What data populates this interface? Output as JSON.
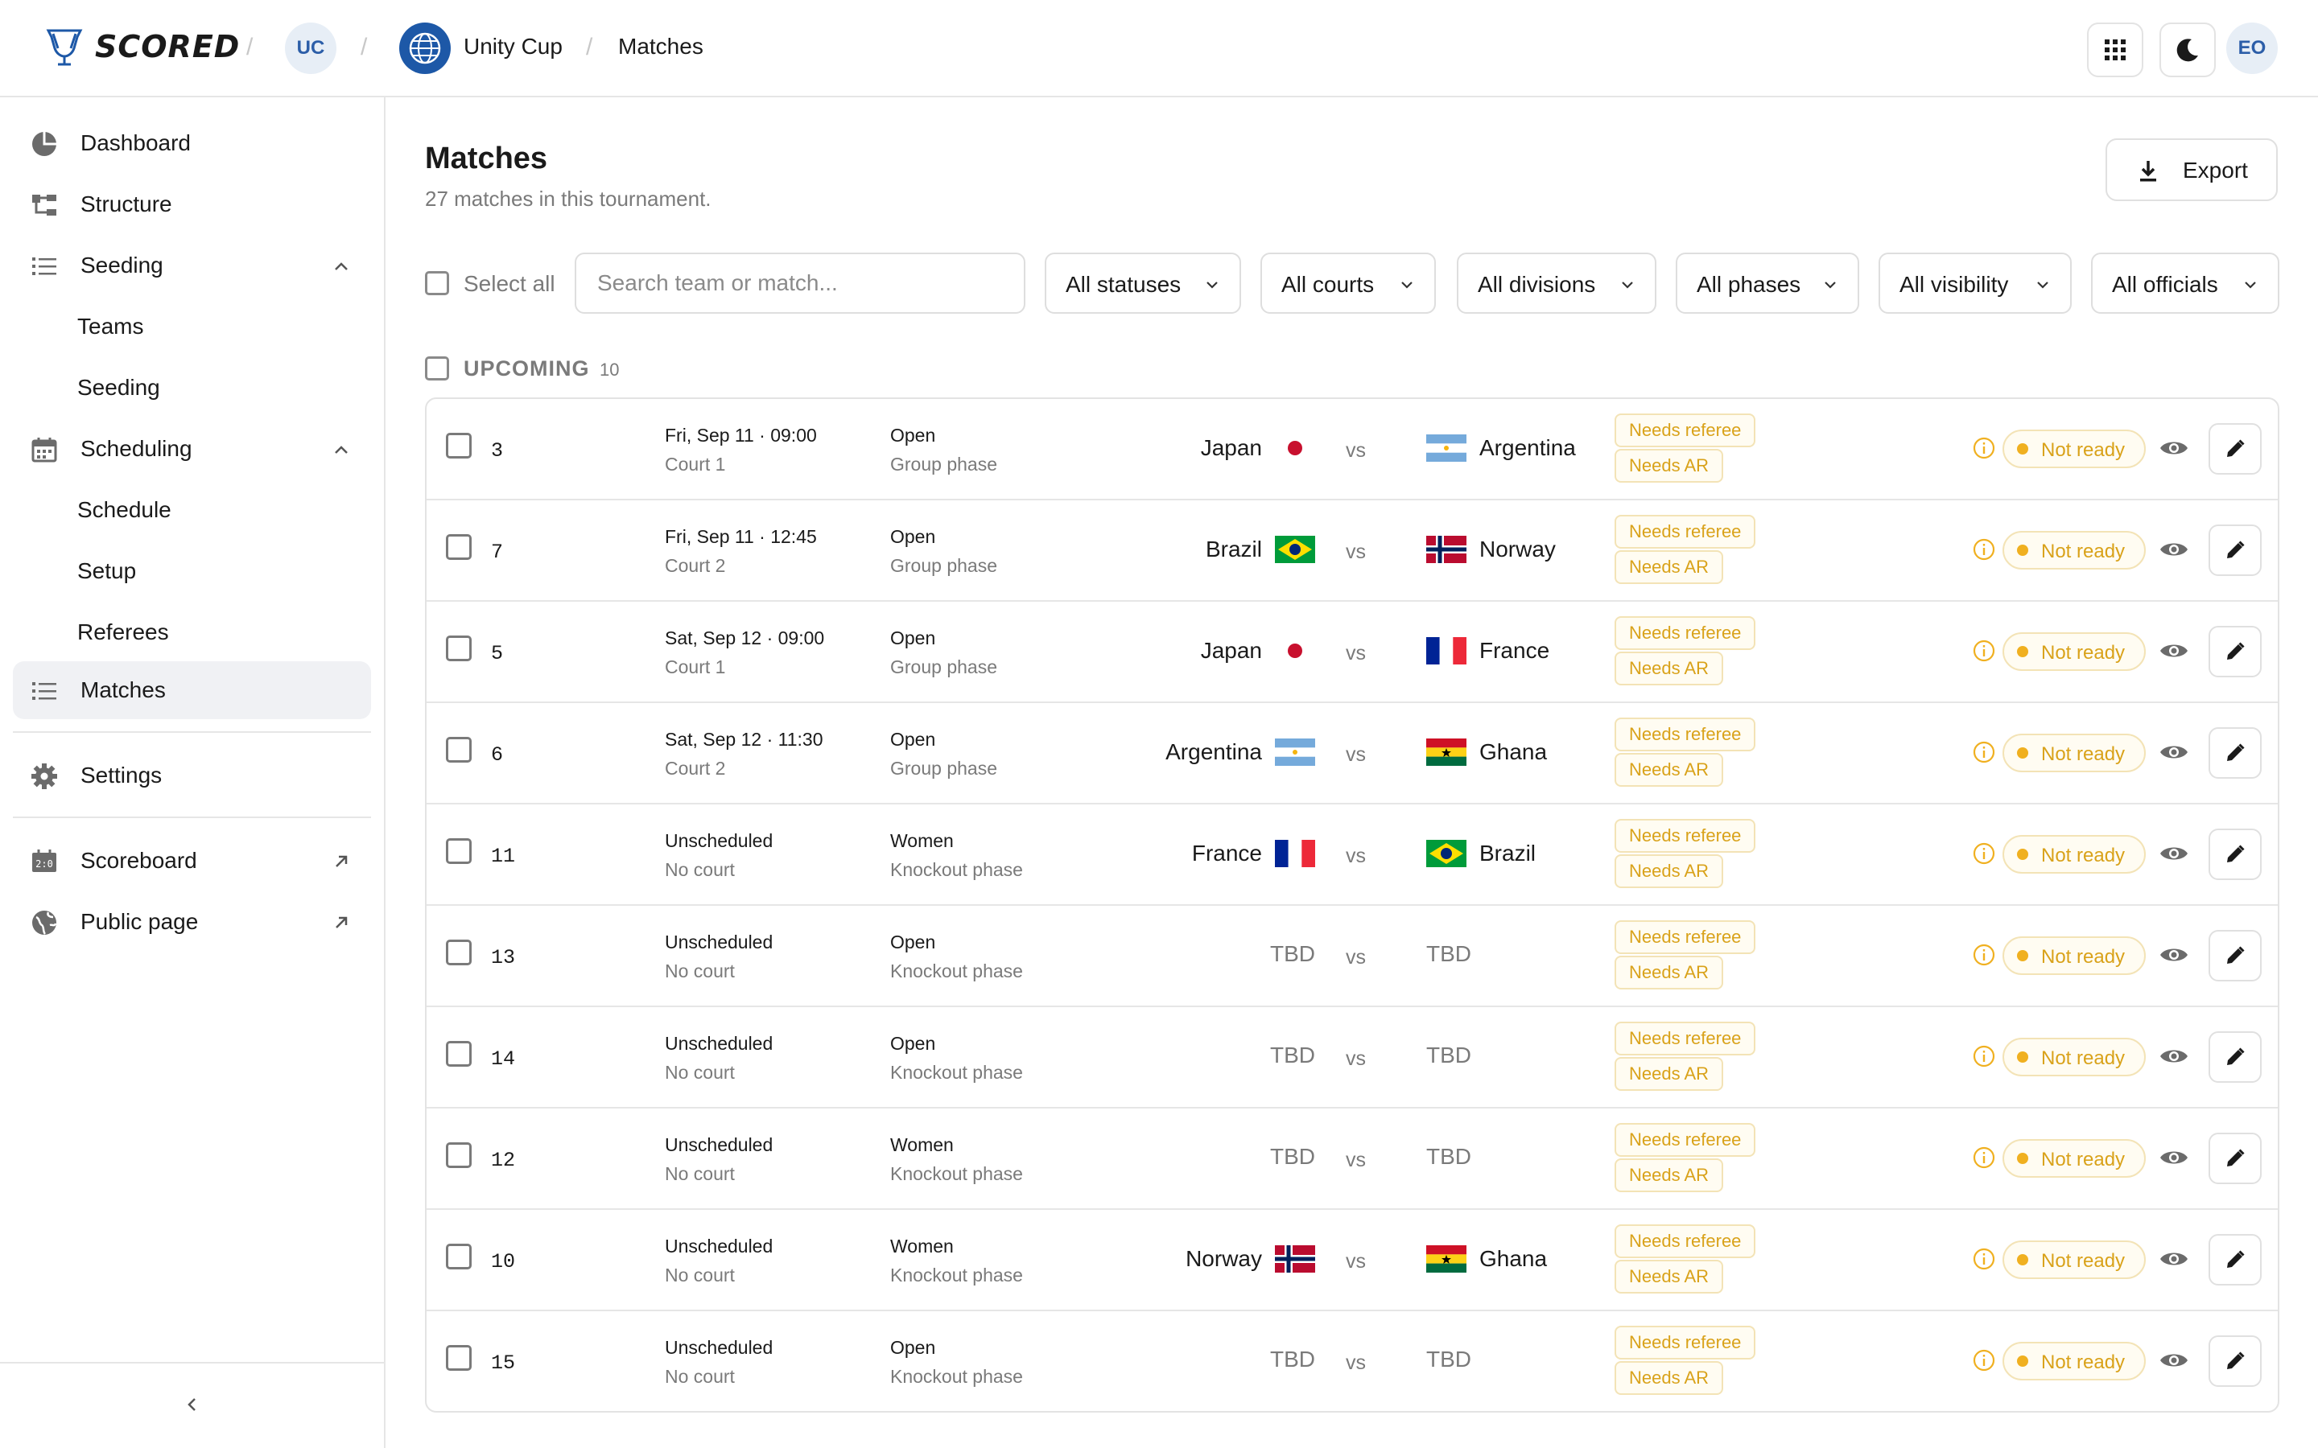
{
  "app": {
    "logo_text": "SCORED",
    "org_initials": "UC",
    "user_initials": "EO"
  },
  "breadcrumb": {
    "tournament": "Unity Cup",
    "page": "Matches"
  },
  "sidebar": {
    "items": [
      {
        "label": "Dashboard",
        "icon": "pie-chart-icon"
      },
      {
        "label": "Structure",
        "icon": "structure-icon"
      },
      {
        "label": "Seeding",
        "icon": "list-icon",
        "expanded": true
      },
      {
        "label": "Teams"
      },
      {
        "label": "Seeding"
      },
      {
        "label": "Scheduling",
        "icon": "calendar-icon",
        "expanded": true
      },
      {
        "label": "Schedule"
      },
      {
        "label": "Setup"
      },
      {
        "label": "Referees"
      },
      {
        "label": "Matches",
        "icon": "list-icon",
        "active": true
      },
      {
        "label": "Settings",
        "icon": "gear-icon"
      },
      {
        "label": "Scoreboard",
        "icon": "scoreboard-icon",
        "external": true
      },
      {
        "label": "Public page",
        "icon": "globe-icon",
        "external": true
      }
    ]
  },
  "page": {
    "title": "Matches",
    "subtitle": "27 matches in this tournament.",
    "export_label": "Export"
  },
  "filters": {
    "select_all": "Select all",
    "search_placeholder": "Search team or match...",
    "items": [
      "All statuses",
      "All courts",
      "All divisions",
      "All phases",
      "All visibility",
      "All officials"
    ]
  },
  "group": {
    "label": "UPCOMING",
    "count": "10"
  },
  "matches": [
    {
      "num": "3",
      "when": "Fri, Sep 11 · 09:00",
      "court": "Court 1",
      "division": "Open",
      "phase": "Group phase",
      "home": "Japan",
      "home_flag": "japan",
      "away": "Argentina",
      "away_flag": "argentina",
      "vs": "vs",
      "tag1": "Needs referee",
      "tag2": "Needs AR",
      "status": "Not ready"
    },
    {
      "num": "7",
      "when": "Fri, Sep 11 · 12:45",
      "court": "Court 2",
      "division": "Open",
      "phase": "Group phase",
      "home": "Brazil",
      "home_flag": "brazil",
      "away": "Norway",
      "away_flag": "norway",
      "vs": "vs",
      "tag1": "Needs referee",
      "tag2": "Needs AR",
      "status": "Not ready"
    },
    {
      "num": "5",
      "when": "Sat, Sep 12 · 09:00",
      "court": "Court 1",
      "division": "Open",
      "phase": "Group phase",
      "home": "Japan",
      "home_flag": "japan",
      "away": "France",
      "away_flag": "france",
      "vs": "vs",
      "tag1": "Needs referee",
      "tag2": "Needs AR",
      "status": "Not ready"
    },
    {
      "num": "6",
      "when": "Sat, Sep 12 · 11:30",
      "court": "Court 2",
      "division": "Open",
      "phase": "Group phase",
      "home": "Argentina",
      "home_flag": "argentina",
      "away": "Ghana",
      "away_flag": "ghana",
      "vs": "vs",
      "tag1": "Needs referee",
      "tag2": "Needs AR",
      "status": "Not ready"
    },
    {
      "num": "11",
      "when": "Unscheduled",
      "court": "No court",
      "division": "Women",
      "phase": "Knockout phase",
      "home": "France",
      "home_flag": "france",
      "away": "Brazil",
      "away_flag": "brazil",
      "vs": "vs",
      "tag1": "Needs referee",
      "tag2": "Needs AR",
      "status": "Not ready"
    },
    {
      "num": "13",
      "when": "Unscheduled",
      "court": "No court",
      "division": "Open",
      "phase": "Knockout phase",
      "home": "TBD",
      "home_flag": "",
      "away": "TBD",
      "away_flag": "",
      "vs": "vs",
      "tag1": "Needs referee",
      "tag2": "Needs AR",
      "status": "Not ready"
    },
    {
      "num": "14",
      "when": "Unscheduled",
      "court": "No court",
      "division": "Open",
      "phase": "Knockout phase",
      "home": "TBD",
      "home_flag": "",
      "away": "TBD",
      "away_flag": "",
      "vs": "vs",
      "tag1": "Needs referee",
      "tag2": "Needs AR",
      "status": "Not ready"
    },
    {
      "num": "12",
      "when": "Unscheduled",
      "court": "No court",
      "division": "Women",
      "phase": "Knockout phase",
      "home": "TBD",
      "home_flag": "",
      "away": "TBD",
      "away_flag": "",
      "vs": "vs",
      "tag1": "Needs referee",
      "tag2": "Needs AR",
      "status": "Not ready"
    },
    {
      "num": "10",
      "when": "Unscheduled",
      "court": "No court",
      "division": "Women",
      "phase": "Knockout phase",
      "home": "Norway",
      "home_flag": "norway",
      "away": "Ghana",
      "away_flag": "ghana",
      "vs": "vs",
      "tag1": "Needs referee",
      "tag2": "Needs AR",
      "status": "Not ready"
    },
    {
      "num": "15",
      "when": "Unscheduled",
      "court": "No court",
      "division": "Open",
      "phase": "Knockout phase",
      "home": "TBD",
      "home_flag": "",
      "away": "TBD",
      "away_flag": "",
      "vs": "vs",
      "tag1": "Needs referee",
      "tag2": "Needs AR",
      "status": "Not ready"
    }
  ],
  "colors": {
    "accent": "#1d58a7",
    "warning": "#d9a21a",
    "warning_dot": "#f0b020",
    "border": "#e3e3e3",
    "muted": "#7a7a7a"
  }
}
